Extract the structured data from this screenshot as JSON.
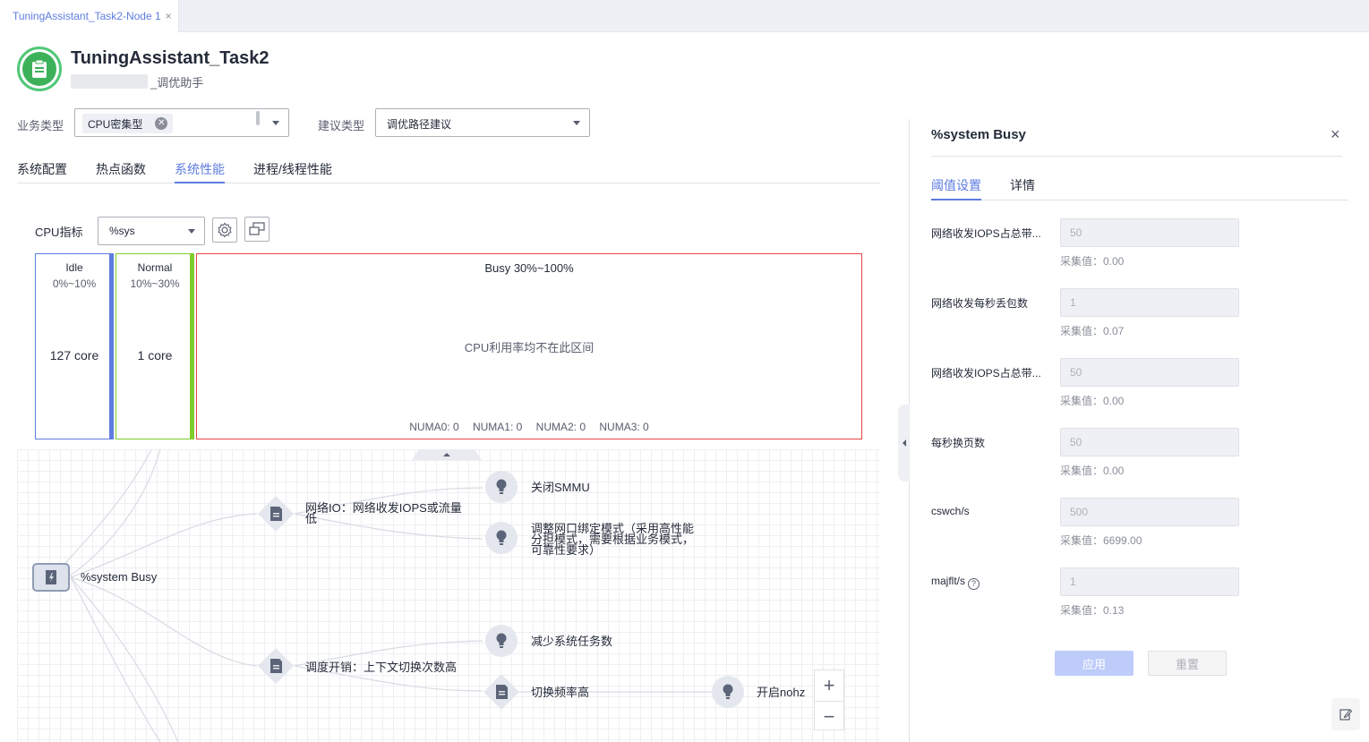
{
  "tab": {
    "label": "TuningAssistant_Task2-Node 1",
    "close": "×"
  },
  "header": {
    "title": "TuningAssistant_Task2",
    "subtitle": "_调优助手"
  },
  "filters": {
    "business_type_label": "业务类型",
    "business_type_chip": "CPU密集型",
    "suggestion_type_label": "建议类型",
    "suggestion_type_value": "调优路径建议"
  },
  "tabs": [
    "系统配置",
    "热点函数",
    "系统性能",
    "进程/线程性能"
  ],
  "active_tab": "系统性能",
  "cpu": {
    "label": "CPU指标",
    "metric": "%sys",
    "buckets": {
      "idle": {
        "name": "Idle",
        "range": "0%~10%",
        "count": "127 core"
      },
      "normal": {
        "name": "Normal",
        "range": "10%~30%",
        "count": "1 core"
      },
      "busy": {
        "name": "Busy 30%~100%",
        "message": "CPU利用率均不在此区间"
      }
    },
    "numa": [
      "NUMA0: 0",
      "NUMA1: 0",
      "NUMA2: 0",
      "NUMA3: 0"
    ],
    "colors": {
      "idle": "#5e7ce0",
      "normal": "#7fcd2b",
      "busy": "#e54545"
    }
  },
  "graph": {
    "root": "%system Busy",
    "net_io": "网络IO：网络收发IOPS或流量低",
    "close_smmu": "关闭SMMU",
    "adjust_nic": "调整网口绑定模式（采用高性能分担模式，需要根据业务模式，可靠性要求）",
    "sched": "调度开销：上下文切换次数高",
    "reduce_tasks": "减少系统任务数",
    "switch_freq": "切换频率高",
    "nohz": "开启nohz",
    "zoom_in": "+",
    "zoom_out": "−"
  },
  "panel": {
    "title": "%system Busy",
    "close": "×",
    "tabs": [
      "阈值设置",
      "详情"
    ],
    "active_tab": "阈值设置",
    "fields": [
      {
        "label": "网络收发IOPS占总带...",
        "value": "50",
        "collected": "采集值：0.00"
      },
      {
        "label": "网络收发每秒丢包数",
        "value": "1",
        "collected": "采集值：0.07"
      },
      {
        "label": "网络收发IOPS占总带...",
        "value": "50",
        "collected": "采集值：0.00"
      },
      {
        "label": "每秒换页数",
        "value": "50",
        "collected": "采集值：0.00"
      },
      {
        "label": "cswch/s",
        "value": "500",
        "collected": "采集值：6699.00"
      },
      {
        "label": "majflt/s",
        "value": "1",
        "collected": "采集值：0.13"
      }
    ],
    "help": "?",
    "apply": "应用",
    "reset": "重置"
  }
}
